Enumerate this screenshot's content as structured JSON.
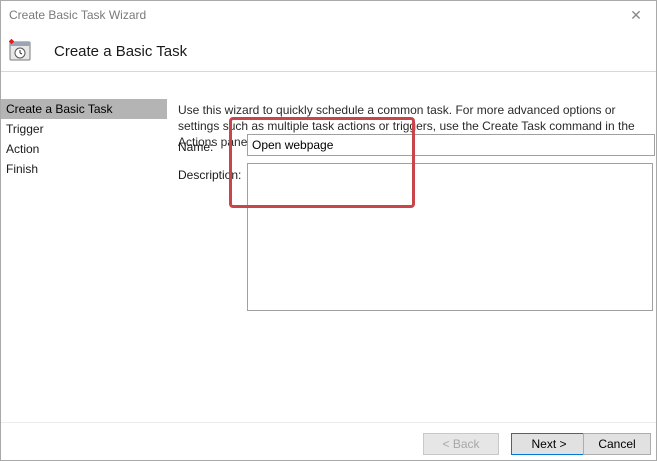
{
  "window": {
    "title": "Create Basic Task Wizard",
    "close_glyph": "✕"
  },
  "header": {
    "title": "Create a Basic Task",
    "icon": "task-scheduler-icon"
  },
  "steps": [
    {
      "label": "Create a Basic Task",
      "active": true
    },
    {
      "label": "Trigger",
      "active": false
    },
    {
      "label": "Action",
      "active": false
    },
    {
      "label": "Finish",
      "active": false
    }
  ],
  "intro_text": "Use this wizard to quickly schedule a common task.  For more advanced options or settings such as multiple task actions or triggers, use the Create Task command in the Actions pane.",
  "form": {
    "name_label": "Name:",
    "name_value": "Open webpage",
    "description_label": "Description:",
    "description_value": ""
  },
  "buttons": {
    "back": "< Back",
    "next": "Next >",
    "cancel": "Cancel"
  },
  "colors": {
    "highlight": "#c9454a",
    "active_step": "#b4b4b4",
    "primary_border": "#0078d7"
  }
}
